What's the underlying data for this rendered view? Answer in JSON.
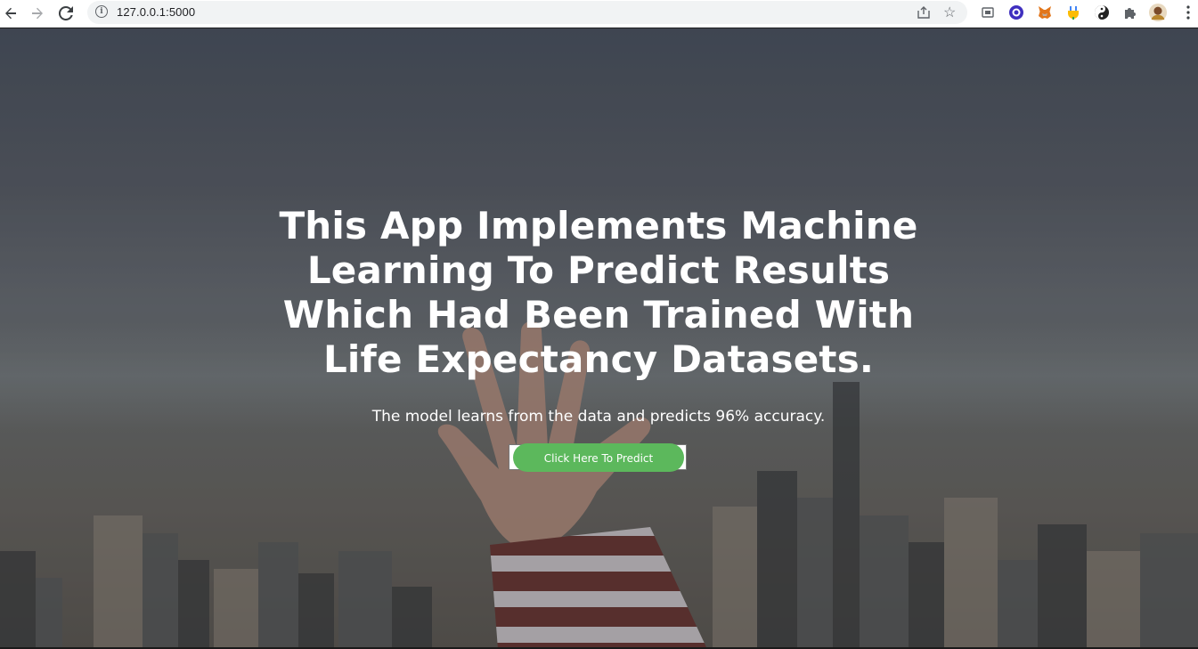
{
  "browser": {
    "url": "127.0.0.1:5000",
    "nav": {
      "back_icon": "arrow-left-icon",
      "forward_icon": "arrow-right-icon",
      "reload_icon": "reload-icon"
    },
    "omnibox_icons": [
      "info-icon",
      "share-icon",
      "star-icon"
    ],
    "extensions": [
      "cast-icon",
      "circle-extension-icon",
      "metamask-fox-icon",
      "plug-extension-icon",
      "yin-yang-icon",
      "puzzle-icon",
      "profile-avatar",
      "kebab-menu-icon"
    ]
  },
  "hero": {
    "title": "This App Implements Machine Learning To Predict Results Which Had Been Trained With Life Expectancy Datasets.",
    "subtitle": "The model learns from the data and predicts 96% accuracy.",
    "button_label": "Click Here To Predict"
  },
  "colors": {
    "button_bg": "#5cb85c",
    "text": "#ffffff",
    "toolbar_bg": "#ffffff",
    "omnibox_bg": "#f1f3f4"
  }
}
